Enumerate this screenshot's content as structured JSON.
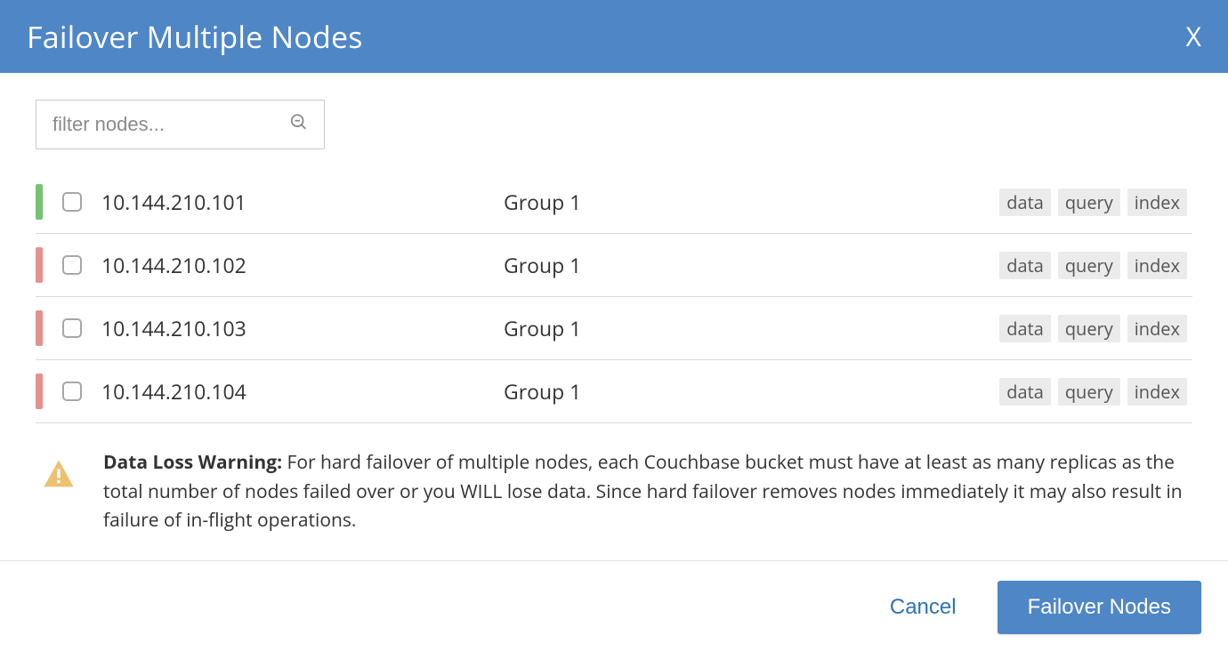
{
  "dialog": {
    "title": "Failover Multiple Nodes",
    "close_label": "X"
  },
  "filter": {
    "placeholder": "filter nodes..."
  },
  "nodes": [
    {
      "status": "green",
      "name": "10.144.210.101",
      "group": "Group 1",
      "services": [
        "data",
        "query",
        "index"
      ]
    },
    {
      "status": "red",
      "name": "10.144.210.102",
      "group": "Group 1",
      "services": [
        "data",
        "query",
        "index"
      ]
    },
    {
      "status": "red",
      "name": "10.144.210.103",
      "group": "Group 1",
      "services": [
        "data",
        "query",
        "index"
      ]
    },
    {
      "status": "red",
      "name": "10.144.210.104",
      "group": "Group 1",
      "services": [
        "data",
        "query",
        "index"
      ]
    }
  ],
  "warning": {
    "bold": "Data Loss Warning:",
    "body": " For hard failover of multiple nodes, each Couchbase bucket must have at least as many replicas as the total number of nodes failed over or you WILL lose data. Since hard failover removes nodes immediately it may also result in failure of in-flight operations."
  },
  "footer": {
    "cancel": "Cancel",
    "confirm": "Failover Nodes"
  }
}
